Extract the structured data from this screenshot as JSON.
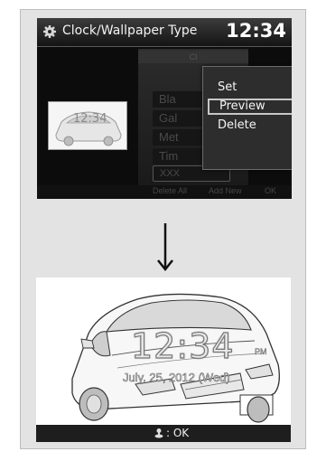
{
  "screen": {
    "title": "Clock/Wallpaper Type",
    "clock": "12:34",
    "list_header": "CI",
    "list_items": [
      "Bla",
      "Gal",
      "Met",
      "Tim",
      "XXX"
    ],
    "footer": [
      "Delete All",
      "Add New",
      "OK"
    ],
    "thumbnail_clock": "12:34",
    "popup_menu": [
      {
        "label": "Set",
        "selected": false
      },
      {
        "label": "Preview",
        "selected": true
      },
      {
        "label": "Delete",
        "selected": false
      }
    ]
  },
  "arrow_icon": "down-arrow-icon",
  "preview": {
    "time": "12:34",
    "ampm": "PM",
    "date": "July. 25, 2012 (Wed)",
    "ok_icon": "joystick-icon",
    "ok_label": ": OK"
  }
}
